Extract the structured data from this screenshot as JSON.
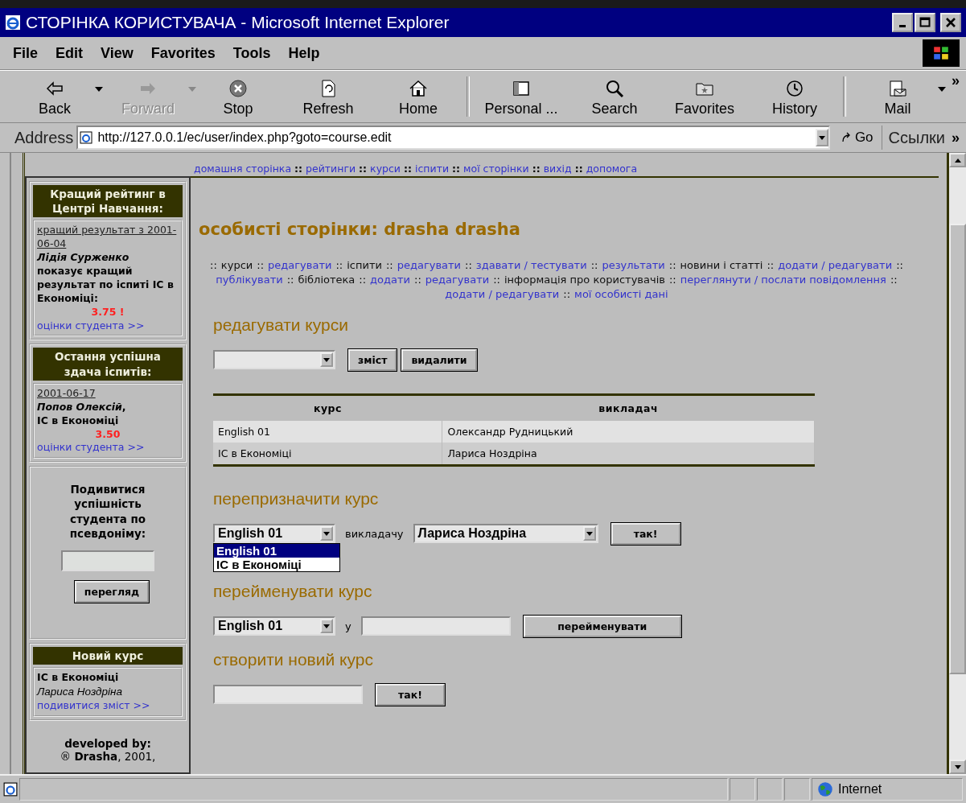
{
  "window": {
    "title": "СТОРІНКА КОРИСТУВАЧА - Microsoft Internet Explorer"
  },
  "menu": [
    "File",
    "Edit",
    "View",
    "Favorites",
    "Tools",
    "Help"
  ],
  "toolbar": {
    "groups": [
      [
        {
          "kind": "back",
          "label": "Back",
          "disabled": false,
          "dropdown": true
        },
        {
          "kind": "forward",
          "label": "Forward",
          "disabled": true,
          "dropdown": true
        },
        {
          "kind": "stop",
          "label": "Stop",
          "disabled": false,
          "dropdown": false
        },
        {
          "kind": "refresh",
          "label": "Refresh",
          "disabled": false,
          "dropdown": false
        },
        {
          "kind": "home",
          "label": "Home",
          "disabled": false,
          "dropdown": false
        }
      ],
      [
        {
          "kind": "personal",
          "label": "Personal ...",
          "disabled": false,
          "dropdown": false
        },
        {
          "kind": "search",
          "label": "Search",
          "disabled": false,
          "dropdown": false
        },
        {
          "kind": "favorites",
          "label": "Favorites",
          "disabled": false,
          "dropdown": false
        },
        {
          "kind": "history",
          "label": "History",
          "disabled": false,
          "dropdown": false
        }
      ],
      [
        {
          "kind": "mail",
          "label": "Mail",
          "disabled": false,
          "dropdown": true
        }
      ]
    ],
    "more": "»"
  },
  "address": {
    "label": "Address",
    "url": "http://127.0.0.1/ec/user/index.php?goto=course.edit",
    "go": "Go",
    "links": "Ссылки",
    "more": "»"
  },
  "top_nav": {
    "separator": "::",
    "links": [
      "домашня сторінка",
      "рейтинги",
      "курси",
      "іспити",
      "мої сторінки",
      "вихід",
      "допомога"
    ]
  },
  "sidebar": {
    "panels": [
      {
        "kind": "info",
        "header": "Кращий рейтинг в Центрі Навчання:",
        "lines": [
          {
            "kind": "date",
            "text": "кращий результат з 2001-06-04"
          },
          {
            "kind": "name",
            "text": "Лідія Сурженко"
          },
          {
            "kind": "bold",
            "text": "показує кращий результат по іспиті IC в Економіці:"
          },
          {
            "kind": "score",
            "text": "3.75 !"
          },
          {
            "kind": "link",
            "text": "оцінки студента >>"
          }
        ]
      },
      {
        "kind": "info",
        "header": "Остання успішна здача іспитів:",
        "lines": [
          {
            "kind": "date",
            "text": "2001-06-17"
          },
          {
            "kind": "bold",
            "text": "*Попов Олексій*,"
          },
          {
            "kind": "bold",
            "text": "IC в Економіці"
          },
          {
            "kind": "score",
            "text": "3.50"
          },
          {
            "kind": "link",
            "text": "оцінки студента >>"
          }
        ]
      },
      {
        "kind": "lookup",
        "text": "Подивитися успішність студента по псевдоніму:",
        "button": "перегляд"
      },
      {
        "kind": "info",
        "header": "Новий курс",
        "lines": [
          {
            "kind": "bold",
            "text": "IC в Економіці"
          },
          {
            "kind": "italic",
            "text": "Лариса Ноздріна"
          },
          {
            "kind": "link",
            "text": "подивитися зміст >>"
          }
        ]
      },
      {
        "kind": "footer",
        "lines": [
          {
            "kind": "bold",
            "text": "developed by:"
          },
          {
            "kind": "plain",
            "text": "® **Drasha**, 2001,"
          }
        ]
      }
    ]
  },
  "main": {
    "title": "особисті сторінки: drasha drasha",
    "subnav": {
      "separator": "::",
      "items": [
        {
          "text": "курси",
          "link": false
        },
        {
          "text": "редагувати",
          "link": true
        },
        {
          "text": "іспити",
          "link": false
        },
        {
          "text": "редагувати",
          "link": true
        },
        {
          "text": "здавати / тестувати",
          "link": true
        },
        {
          "text": "результати",
          "link": true
        },
        {
          "text": "новини і статті",
          "link": false
        },
        {
          "text": "додати / редагувати",
          "link": true
        },
        {
          "text": "публікувати",
          "link": true
        },
        {
          "text": "бібліотека",
          "link": false
        },
        {
          "text": "додати",
          "link": true
        },
        {
          "text": "редагувати",
          "link": true
        },
        {
          "text": "інформація про користувачів",
          "link": false
        },
        {
          "text": "переглянути / послати повідомлення",
          "link": true
        },
        {
          "text": "додати / редагувати",
          "link": true
        },
        {
          "text": "мої особисті дані",
          "link": true
        }
      ]
    },
    "edit": {
      "title": "редагувати курси",
      "buttons": [
        "зміст",
        "видалити"
      ]
    },
    "table": {
      "columns": [
        "курс",
        "викладач"
      ],
      "rows": [
        [
          "English 01",
          "Олександр Рудницький"
        ],
        [
          "IC в Економіці",
          "Лариса Ноздріна"
        ]
      ]
    },
    "reassign": {
      "title": "перепризначити курс",
      "course": "English 01",
      "options": [
        {
          "label": "English 01",
          "selected": true
        },
        {
          "label": "IC в Економіці",
          "selected": false
        }
      ],
      "label": "викладачу",
      "teacher": "Лариса Ноздріна",
      "button": "так!"
    },
    "rename": {
      "title": "перейменувати курс",
      "course": "English 01",
      "label": "у",
      "button": "перейменувати"
    },
    "create": {
      "title": "створити новий курс",
      "button": "так!"
    }
  },
  "status_bar": {
    "zone": "Internet"
  }
}
